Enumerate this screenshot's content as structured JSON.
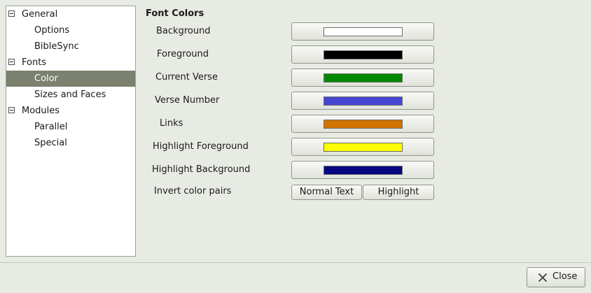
{
  "tree": {
    "items": [
      {
        "label": "General",
        "expanded": true
      },
      {
        "label": "Options"
      },
      {
        "label": "BibleSync"
      },
      {
        "label": "Fonts",
        "expanded": true
      },
      {
        "label": "Color",
        "selected": true
      },
      {
        "label": "Sizes and Faces"
      },
      {
        "label": "Modules",
        "expanded": true
      },
      {
        "label": "Parallel"
      },
      {
        "label": "Special"
      }
    ]
  },
  "main": {
    "section_title": "Font Colors",
    "colors": [
      {
        "label": "Background",
        "color": "#ffffff"
      },
      {
        "label": "Foreground",
        "color": "#000000"
      },
      {
        "label": "Current Verse",
        "color": "#008800"
      },
      {
        "label": "Verse Number",
        "color": "#4646d2"
      },
      {
        "label": "Links",
        "color": "#d27300"
      },
      {
        "label": "Highlight Foreground",
        "color": "#ffff00"
      },
      {
        "label": "Highlight Background",
        "color": "#060682"
      }
    ],
    "invert_label": "Invert color pairs",
    "invert_buttons": [
      "Normal Text",
      "Highlight"
    ]
  },
  "footer": {
    "close_label": "Close",
    "close_icon": "close-icon"
  }
}
